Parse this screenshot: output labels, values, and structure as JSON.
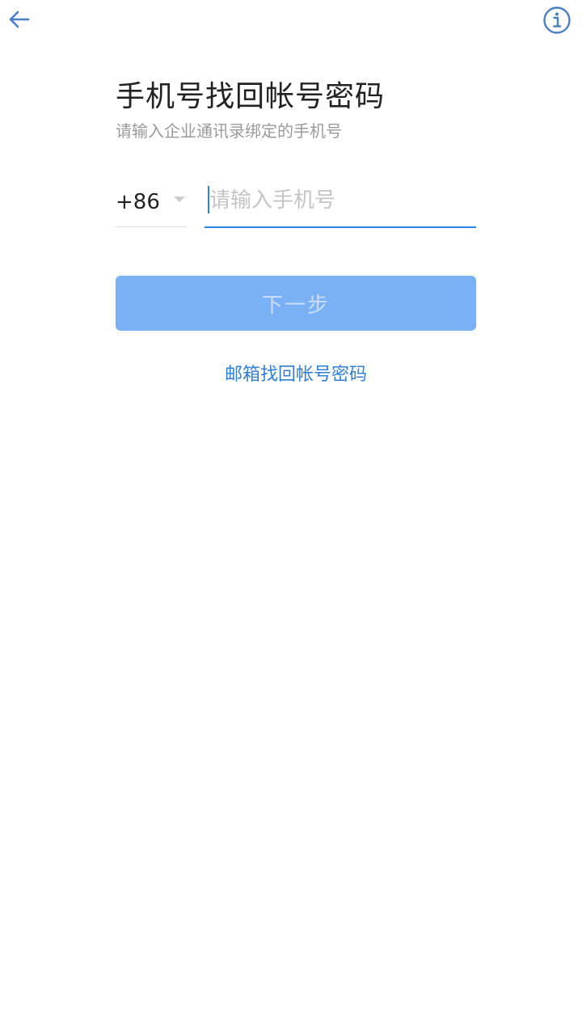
{
  "header": {
    "back_icon": "arrow-left-icon",
    "info_icon": "info-circle-icon"
  },
  "title": "手机号找回帐号密码",
  "subtitle": "请输入企业通讯录绑定的手机号",
  "form": {
    "country_code": "+86",
    "phone_placeholder": "请输入手机号",
    "phone_value": ""
  },
  "actions": {
    "next_label": "下一步",
    "email_recovery_label": "邮箱找回帐号密码"
  },
  "colors": {
    "accent": "#2b84e8",
    "button_disabled_bg": "#7ab1f5",
    "link": "#2f7fd6"
  }
}
